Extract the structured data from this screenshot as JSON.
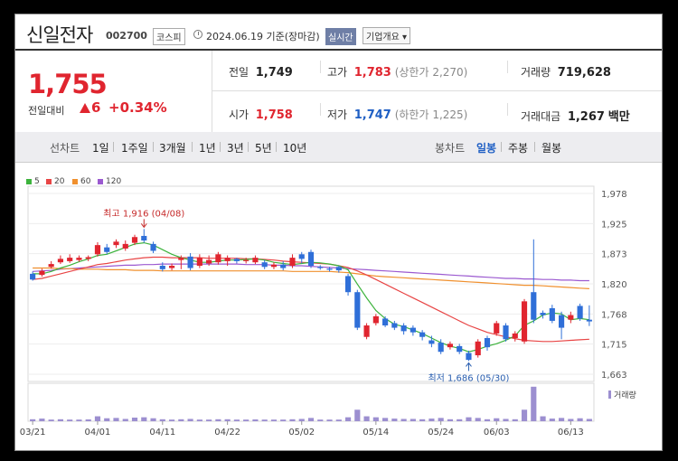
{
  "header": {
    "name": "신일전자",
    "code": "002700",
    "market": "코스피",
    "date": "2024.06.19 기준(장마감)",
    "realtime": "실시간",
    "company_info": "기업개요 ▾"
  },
  "summary": {
    "price": "1,755",
    "change_label": "전일대비",
    "change": "6",
    "change_pct": "+0.34%",
    "prev_close_label": "전일",
    "prev_close": "1,749",
    "high_label": "고가",
    "high": "1,783",
    "upper_limit_label": "(상한가",
    "upper_limit": "2,270)",
    "volume_label": "거래량",
    "volume": "719,628",
    "open_label": "시가",
    "open": "1,758",
    "low_label": "저가",
    "low": "1,747",
    "lower_limit_label": "(하한가",
    "lower_limit": "1,225)",
    "amount_label": "거래대금",
    "amount": "1,267",
    "amount_unit": "백만"
  },
  "periods": {
    "line_label": "선차트",
    "items": [
      "1일",
      "1주일",
      "3개월",
      "1년",
      "3년",
      "5년",
      "10년"
    ],
    "candle_label": "봉차트",
    "candle_items": [
      "일봉",
      "주봉",
      "월봉"
    ],
    "selected_candle": "일봉"
  },
  "colors": {
    "up": "#e0252f",
    "down": "#2f6fd8",
    "ma5": "#3db33d",
    "ma20": "#e84545",
    "ma60": "#f0902e",
    "ma120": "#9b59d0",
    "volume": "#9c8fd0"
  },
  "chart_data": {
    "type": "candlestick",
    "ylim": [
      1663,
      1978
    ],
    "yticks": [
      "1,978",
      "1,925",
      "1,873",
      "1,820",
      "1,768",
      "1,715",
      "1,663"
    ],
    "xticks": [
      {
        "label": "03/21",
        "i": 0
      },
      {
        "label": "04/01",
        "i": 7
      },
      {
        "label": "04/11",
        "i": 14
      },
      {
        "label": "04/22",
        "i": 21
      },
      {
        "label": "05/02",
        "i": 29
      },
      {
        "label": "05/14",
        "i": 37
      },
      {
        "label": "05/24",
        "i": 44
      },
      {
        "label": "06/03",
        "i": 50
      },
      {
        "label": "06/13",
        "i": 58
      }
    ],
    "legend": [
      {
        "name": "5",
        "color": "#3db33d"
      },
      {
        "name": "20",
        "color": "#e84545"
      },
      {
        "name": "60",
        "color": "#f0902e"
      },
      {
        "name": "120",
        "color": "#9b59d0"
      }
    ],
    "max_annotation": "최고 1,916 (04/08)",
    "max_index": 12,
    "max_value": 1916,
    "min_annotation": "최저 1,686 (05/30)",
    "min_index": 47,
    "min_value": 1686,
    "volume_label": "거래량",
    "candles": [
      [
        1838,
        1828,
        1842,
        1826
      ],
      [
        1836,
        1843,
        1847,
        1833
      ],
      [
        1850,
        1855,
        1860,
        1847
      ],
      [
        1858,
        1864,
        1870,
        1855
      ],
      [
        1860,
        1866,
        1872,
        1857
      ],
      [
        1862,
        1866,
        1870,
        1859
      ],
      [
        1864,
        1867,
        1870,
        1860
      ],
      [
        1872,
        1888,
        1893,
        1868
      ],
      [
        1884,
        1876,
        1890,
        1872
      ],
      [
        1888,
        1894,
        1898,
        1883
      ],
      [
        1882,
        1890,
        1896,
        1878
      ],
      [
        1892,
        1902,
        1906,
        1888
      ],
      [
        1904,
        1896,
        1916,
        1892
      ],
      [
        1890,
        1878,
        1894,
        1874
      ],
      [
        1852,
        1846,
        1858,
        1842
      ],
      [
        1848,
        1852,
        1856,
        1844
      ],
      [
        1862,
        1866,
        1870,
        1846
      ],
      [
        1868,
        1848,
        1874,
        1844
      ],
      [
        1852,
        1866,
        1872,
        1848
      ],
      [
        1856,
        1862,
        1870,
        1852
      ],
      [
        1858,
        1872,
        1876,
        1854
      ],
      [
        1860,
        1866,
        1870,
        1852
      ],
      [
        1864,
        1860,
        1866,
        1856
      ],
      [
        1860,
        1862,
        1866,
        1856
      ],
      [
        1858,
        1866,
        1870,
        1855
      ],
      [
        1858,
        1850,
        1862,
        1846
      ],
      [
        1850,
        1854,
        1858,
        1846
      ],
      [
        1854,
        1848,
        1860,
        1844
      ],
      [
        1852,
        1866,
        1872,
        1848
      ],
      [
        1872,
        1864,
        1876,
        1856
      ],
      [
        1876,
        1852,
        1880,
        1848
      ],
      [
        1850,
        1848,
        1853,
        1845
      ],
      [
        1847,
        1845,
        1850,
        1842
      ],
      [
        1850,
        1844,
        1852,
        1840
      ],
      [
        1834,
        1806,
        1838,
        1800
      ],
      [
        1806,
        1744,
        1810,
        1740
      ],
      [
        1728,
        1748,
        1752,
        1724
      ],
      [
        1752,
        1764,
        1768,
        1748
      ],
      [
        1760,
        1748,
        1764,
        1745
      ],
      [
        1752,
        1744,
        1756,
        1740
      ],
      [
        1748,
        1738,
        1752,
        1732
      ],
      [
        1744,
        1736,
        1748,
        1730
      ],
      [
        1736,
        1728,
        1740,
        1722
      ],
      [
        1722,
        1716,
        1730,
        1710
      ],
      [
        1718,
        1702,
        1724,
        1698
      ],
      [
        1710,
        1716,
        1720,
        1706
      ],
      [
        1712,
        1702,
        1716,
        1698
      ],
      [
        1700,
        1688,
        1704,
        1686
      ],
      [
        1696,
        1720,
        1724,
        1692
      ],
      [
        1726,
        1710,
        1730,
        1704
      ],
      [
        1734,
        1752,
        1756,
        1730
      ],
      [
        1748,
        1724,
        1752,
        1720
      ],
      [
        1726,
        1734,
        1738,
        1720
      ],
      [
        1720,
        1790,
        1794,
        1716
      ],
      [
        1806,
        1758,
        1898,
        1752
      ],
      [
        1770,
        1766,
        1774,
        1760
      ],
      [
        1778,
        1756,
        1784,
        1752
      ],
      [
        1766,
        1744,
        1772,
        1724
      ],
      [
        1758,
        1766,
        1772,
        1752
      ],
      [
        1782,
        1760,
        1786,
        1756
      ],
      [
        1758,
        1755,
        1783,
        1747
      ]
    ],
    "ma5": [
      1838,
      1838,
      1842,
      1848,
      1853,
      1859,
      1864,
      1870,
      1872,
      1878,
      1884,
      1890,
      1892,
      1888,
      1880,
      1872,
      1866,
      1862,
      1858,
      1858,
      1860,
      1862,
      1862,
      1863,
      1864,
      1862,
      1858,
      1856,
      1854,
      1856,
      1858,
      1857,
      1855,
      1852,
      1845,
      1820,
      1796,
      1774,
      1760,
      1750,
      1746,
      1740,
      1734,
      1726,
      1718,
      1712,
      1708,
      1702,
      1706,
      1712,
      1716,
      1722,
      1730,
      1748,
      1756,
      1766,
      1770,
      1768,
      1758,
      1760,
      1758
    ],
    "ma20": [
      1828,
      1830,
      1834,
      1838,
      1842,
      1846,
      1850,
      1854,
      1856,
      1859,
      1862,
      1864,
      1866,
      1867,
      1867,
      1866,
      1866,
      1866,
      1866,
      1865,
      1865,
      1865,
      1865,
      1864,
      1864,
      1863,
      1862,
      1860,
      1859,
      1858,
      1857,
      1856,
      1855,
      1852,
      1849,
      1843,
      1836,
      1828,
      1820,
      1812,
      1804,
      1796,
      1788,
      1780,
      1772,
      1764,
      1756,
      1748,
      1742,
      1736,
      1732,
      1728,
      1725,
      1722,
      1721,
      1720,
      1720,
      1721,
      1722,
      1723,
      1724
    ],
    "ma60": [
      1848,
      1848,
      1848,
      1847,
      1847,
      1846,
      1846,
      1846,
      1845,
      1845,
      1845,
      1844,
      1844,
      1844,
      1843,
      1843,
      1843,
      1843,
      1843,
      1843,
      1843,
      1843,
      1843,
      1843,
      1843,
      1843,
      1843,
      1843,
      1842,
      1842,
      1842,
      1842,
      1842,
      1841,
      1840,
      1838,
      1836,
      1834,
      1833,
      1832,
      1831,
      1830,
      1829,
      1828,
      1827,
      1826,
      1825,
      1824,
      1823,
      1822,
      1821,
      1820,
      1819,
      1818,
      1818,
      1817,
      1816,
      1815,
      1814,
      1813,
      1812
    ],
    "ma120": [
      1842,
      1843,
      1844,
      1846,
      1847,
      1848,
      1849,
      1850,
      1851,
      1852,
      1853,
      1853,
      1854,
      1854,
      1855,
      1855,
      1855,
      1855,
      1855,
      1855,
      1855,
      1855,
      1855,
      1854,
      1854,
      1854,
      1853,
      1853,
      1852,
      1852,
      1851,
      1850,
      1849,
      1848,
      1847,
      1846,
      1845,
      1844,
      1843,
      1842,
      1841,
      1840,
      1839,
      1838,
      1837,
      1836,
      1835,
      1834,
      1833,
      1832,
      1831,
      1830,
      1830,
      1829,
      1829,
      1828,
      1828,
      1827,
      1827,
      1826,
      1826
    ],
    "volume": [
      12,
      16,
      10,
      12,
      10,
      10,
      11,
      30,
      18,
      20,
      14,
      22,
      24,
      18,
      12,
      10,
      12,
      14,
      10,
      10,
      12,
      12,
      10,
      10,
      11,
      10,
      10,
      10,
      12,
      14,
      20,
      10,
      10,
      10,
      24,
      70,
      30,
      24,
      20,
      16,
      14,
      14,
      12,
      16,
      20,
      12,
      12,
      24,
      20,
      12,
      18,
      14,
      12,
      70,
      210,
      30,
      16,
      20,
      14,
      18,
      14
    ],
    "volume_max": 220
  }
}
